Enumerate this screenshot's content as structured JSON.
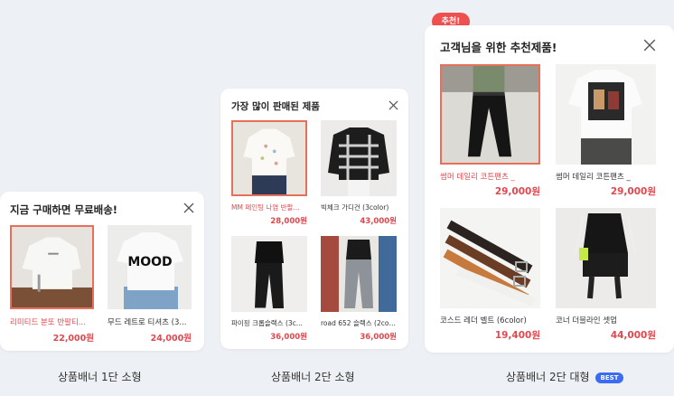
{
  "captions": {
    "small1": "상품배너 1단 소형",
    "small2": "상품배너 2단 소형",
    "large2": "상품배너 2단 대형",
    "best": "BEST"
  },
  "bubble": "추천!",
  "colors": {
    "accent": "#e0474f",
    "selected_border": "#e8705a",
    "best_badge": "#3b6cf2",
    "background": "#edf0f4"
  },
  "card1": {
    "title": "지금 구매하면 무료배송!",
    "close_icon": "close-icon",
    "products": [
      {
        "name": "리미티드 분또 반팔티...",
        "price": "22,000원",
        "selected": true
      },
      {
        "name": "무드 레트로 티셔츠 (3...",
        "price": "24,000원",
        "selected": false
      }
    ]
  },
  "card2": {
    "title": "가장 많이 판매된 제품",
    "close_icon": "close-icon",
    "products": [
      {
        "name": "MM 페인팅 나염 반팔...",
        "price": "28,000원",
        "selected": true
      },
      {
        "name": "빅체크 가디건 (3color)",
        "price": "43,000원",
        "selected": false
      },
      {
        "name": "파이핑 크롭슬랙스 (3c...",
        "price": "36,000원",
        "selected": false
      },
      {
        "name": "road 652 슬랙스 (2col...",
        "price": "36,000원",
        "selected": false
      }
    ]
  },
  "card3": {
    "title": "고객님을 위한 추천제품!",
    "close_icon": "close-icon",
    "products": [
      {
        "name": "썸머 데일리 코튼팬츠 _",
        "price": "29,000원",
        "selected": true
      },
      {
        "name": "썸머 데일리 코튼팬츠 _",
        "price": "29,000원",
        "selected": false
      },
      {
        "name": "코스드 레더 벨트 (6color)",
        "price": "19,400원",
        "selected": false
      },
      {
        "name": "코너 더블라인 셋업",
        "price": "44,000원",
        "selected": false
      }
    ]
  }
}
